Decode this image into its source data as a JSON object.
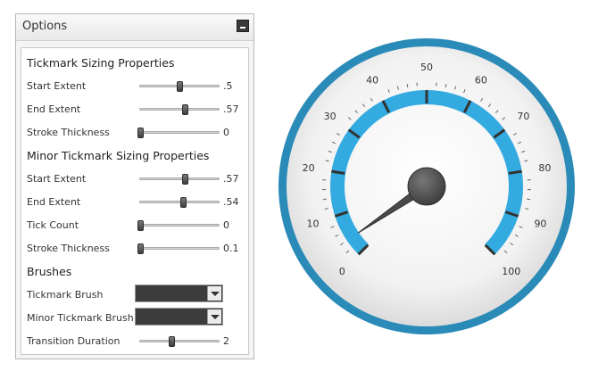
{
  "panel": {
    "title": "Options",
    "sections": {
      "tickmark": "Tickmark Sizing Properties",
      "minor": "Minor Tickmark Sizing Properties",
      "brushes": "Brushes"
    },
    "rows": {
      "start_extent": {
        "label": "Start Extent",
        "value": ".5",
        "fraction": 0.5
      },
      "end_extent": {
        "label": "End Extent",
        "value": ".57",
        "fraction": 0.57
      },
      "stroke_thickness": {
        "label": "Stroke Thickness",
        "value": "0",
        "fraction": 0.0
      },
      "minor_start_extent": {
        "label": "Start Extent",
        "value": ".57",
        "fraction": 0.57
      },
      "minor_end_extent": {
        "label": "End Extent",
        "value": ".54",
        "fraction": 0.54
      },
      "tick_count": {
        "label": "Tick Count",
        "value": "0",
        "fraction": 0.0
      },
      "minor_stroke_thickness": {
        "label": "Stroke Thickness",
        "value": "0.1",
        "fraction": 0.0
      },
      "transition_duration": {
        "label": "Transition Duration",
        "value": "2",
        "fraction": 0.4
      }
    },
    "brushes": {
      "tickmark": {
        "label": "Tickmark Brush",
        "color": "#3c3c3c"
      },
      "minor_tickmark": {
        "label": "Minor Tickmark Brush",
        "color": "#3c3c3c"
      }
    }
  },
  "gauge": {
    "min": 0,
    "max": 100,
    "major_interval": 10,
    "minor_interval": 2,
    "start_angle_deg": 135,
    "sweep_deg": 270,
    "needle_value": 4,
    "tick_labels": [
      "0",
      "10",
      "20",
      "30",
      "40",
      "50",
      "60",
      "70",
      "80",
      "90",
      "100"
    ],
    "colors": {
      "bezel": "#2a8ab8",
      "face": "#ececec",
      "band": "#33aae0",
      "ticks": "#333333",
      "needle": "#4a4a4a",
      "labels": "#333333"
    }
  }
}
